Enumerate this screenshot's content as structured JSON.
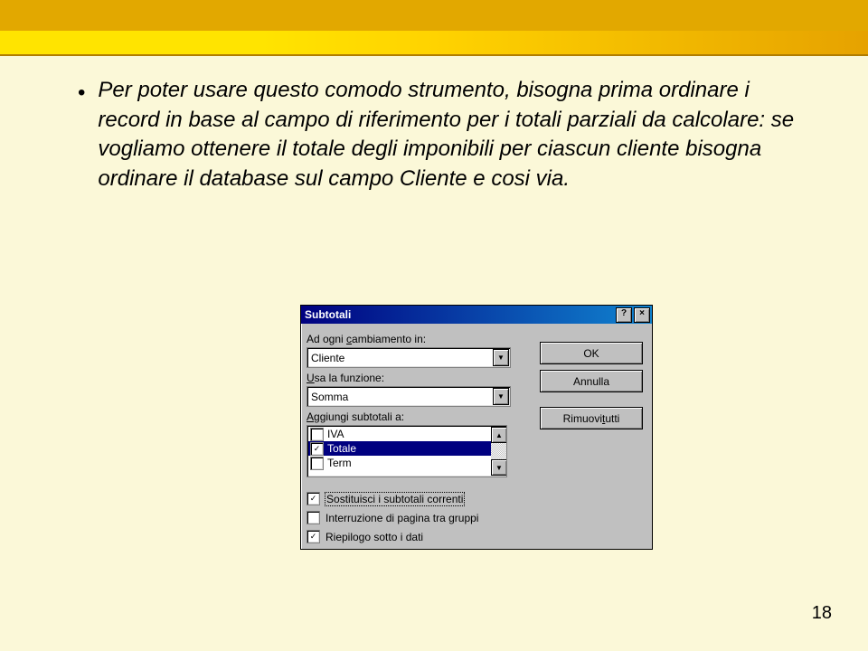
{
  "header": {},
  "bullet": {
    "text": "Per poter usare questo comodo strumento, bisogna prima ordinare i record in base al campo di riferimento per i totali parziali da calcolare: se vogliamo ottenere il totale degli imponibili per ciascun cliente bisogna ordinare il database sul campo Cliente e cosi via."
  },
  "dialog": {
    "title": "Subtotali",
    "help_btn": "?",
    "close_btn": "×",
    "labels": {
      "change_at": "Ad ogni cambiamento in:",
      "use_function": "Usa la funzione:",
      "add_subtotals": "Aggiungi subtotali a:"
    },
    "combo_change_value": "Cliente",
    "combo_function_value": "Somma",
    "list": {
      "items": [
        {
          "label": "IVA",
          "checked": false,
          "selected": false
        },
        {
          "label": "Totale",
          "checked": true,
          "selected": true
        },
        {
          "label": "Term",
          "checked": false,
          "selected": false
        }
      ]
    },
    "buttons": {
      "ok": "OK",
      "cancel": "Annulla",
      "remove_all_pre": "Rimuovi ",
      "remove_all_ul": "t",
      "remove_all_post": "utti"
    },
    "checkboxes": {
      "replace_pre": "",
      "replace_ul": "S",
      "replace_post": "ostituisci i subtotali correnti",
      "replace_checked": "✓",
      "pagebreak_pre": "Interruzione di ",
      "pagebreak_ul": "p",
      "pagebreak_post": "agina tra gruppi",
      "pagebreak_checked": "",
      "summary_pre": "Riepilogo sotto i ",
      "summary_ul": "d",
      "summary_post": "ati",
      "summary_checked": "✓"
    }
  },
  "page_number": "18"
}
